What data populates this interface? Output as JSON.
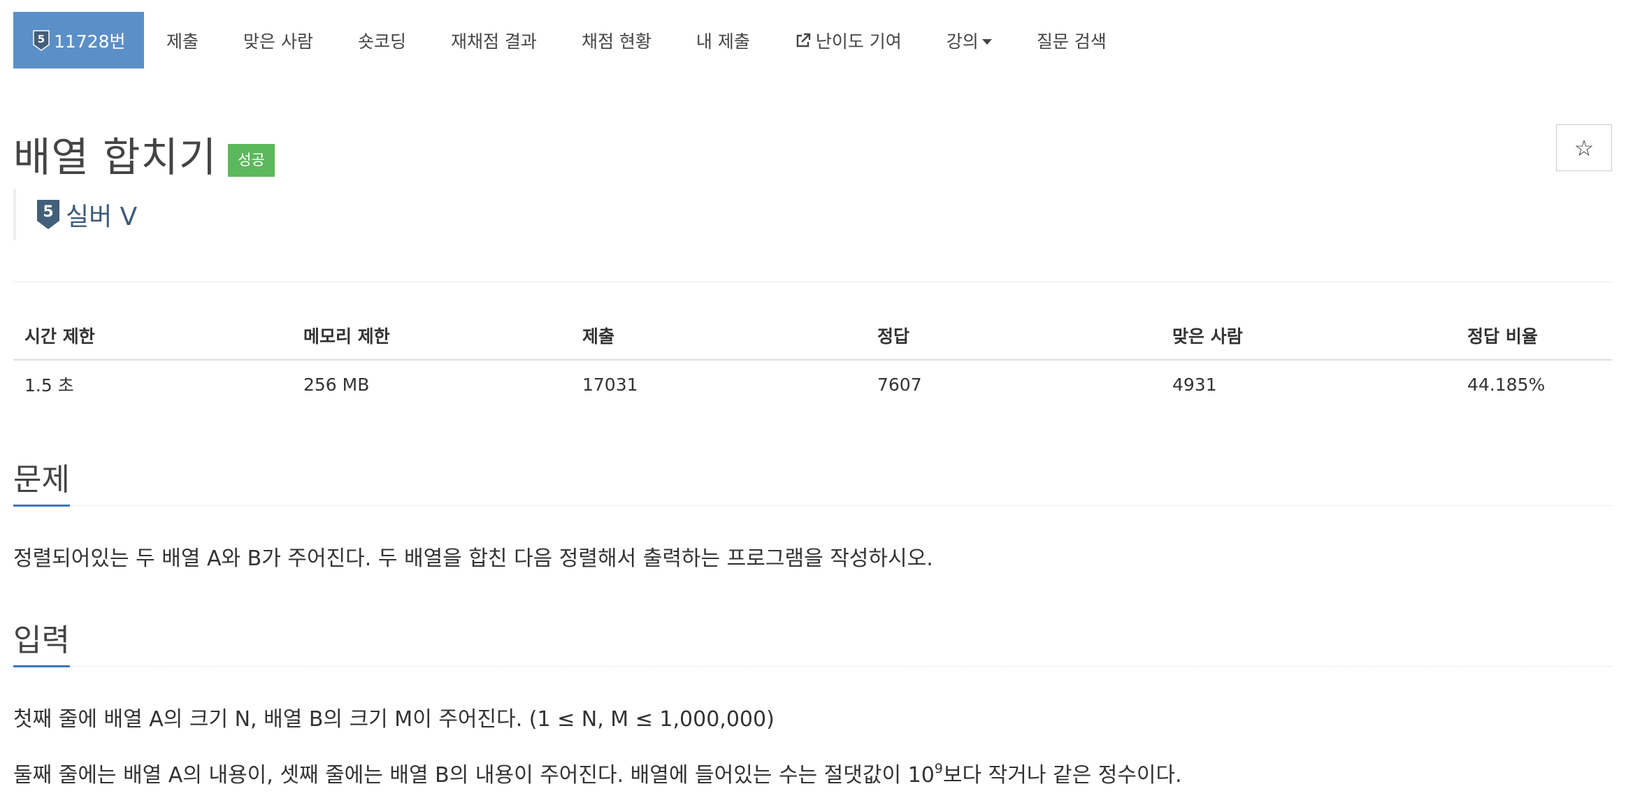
{
  "nav": {
    "problem_number": "11728번",
    "items": [
      {
        "label": "제출"
      },
      {
        "label": "맞은 사람"
      },
      {
        "label": "숏코딩"
      },
      {
        "label": "재채점 결과"
      },
      {
        "label": "채점 현황"
      },
      {
        "label": "내 제출"
      },
      {
        "label": "난이도 기여",
        "icon": "external-link-icon"
      },
      {
        "label": "강의",
        "icon": "chevron-down-icon"
      },
      {
        "label": "질문 검색"
      }
    ]
  },
  "problem": {
    "title": "배열 합치기",
    "result_label": "성공",
    "star_symbol": "☆",
    "tier": {
      "level": "5",
      "name": "실버 V",
      "color": "#435f7a"
    }
  },
  "stats": {
    "headers": [
      "시간 제한",
      "메모리 제한",
      "제출",
      "정답",
      "맞은 사람",
      "정답 비율"
    ],
    "values": [
      "1.5 초",
      "256 MB",
      "17031",
      "7607",
      "4931",
      "44.185%"
    ]
  },
  "sections": {
    "problem": {
      "title": "문제",
      "text": "정렬되어있는 두 배열 A와 B가 주어진다. 두 배열을 합친 다음 정렬해서 출력하는 프로그램을 작성하시오."
    },
    "input": {
      "title": "입력",
      "line1": "첫째 줄에 배열 A의 크기 N, 배열 B의 크기 M이 주어진다. (1 ≤ N, M ≤ 1,000,000)",
      "line2_before": "둘째 줄에는 배열 A의 내용이, 셋째 줄에는 배열 B의 내용이 주어진다. 배열에 들어있는 수는 절댓값이 10",
      "line2_sup": "9",
      "line2_after": "보다 작거나 같은 정수이다."
    }
  },
  "colors": {
    "nav_active": "#5b8fc8",
    "success": "#5cb85c",
    "section_underline": "#3b77b8"
  }
}
